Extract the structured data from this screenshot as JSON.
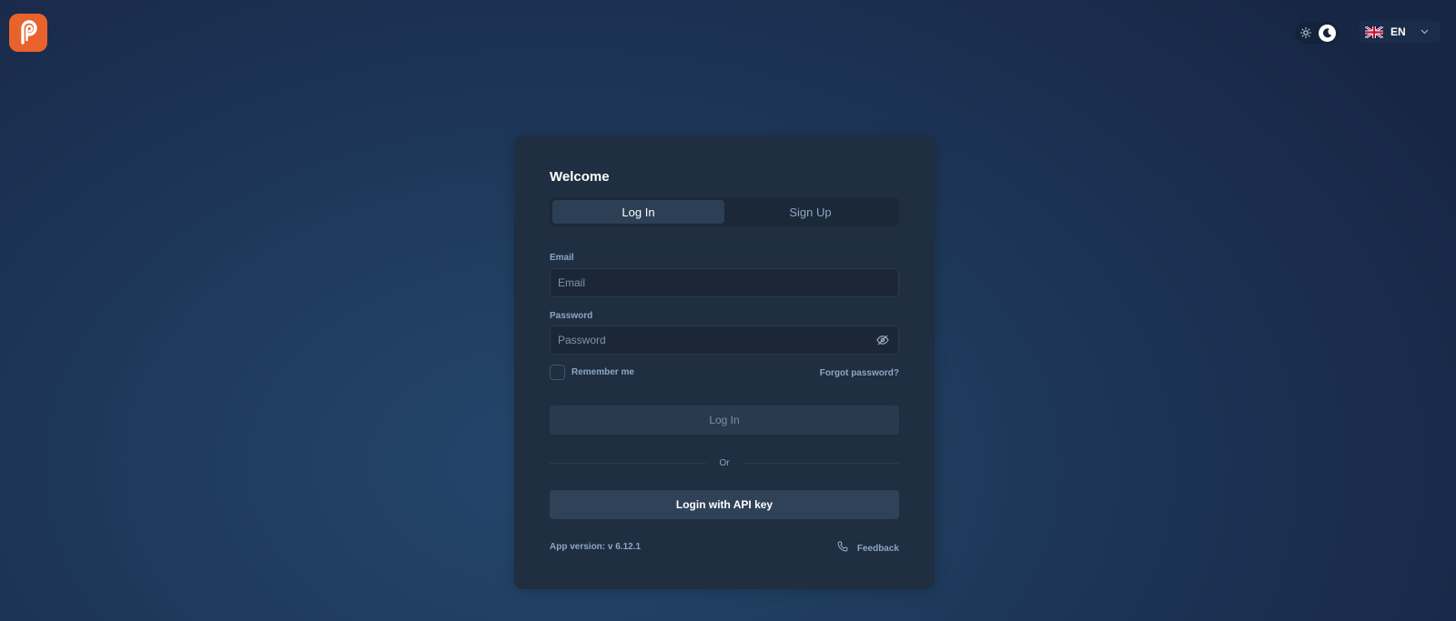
{
  "header": {
    "logo_icon": "app-logo-p-icon",
    "theme_toggle": {
      "light_icon": "sun-icon",
      "dark_icon": "moon-icon",
      "selected": "dark"
    },
    "language": {
      "flag_icon": "uk-flag-icon",
      "code": "EN",
      "chevron_icon": "chevron-down-icon"
    }
  },
  "login_card": {
    "title": "Welcome",
    "tabs": [
      {
        "label": "Log In",
        "active": true
      },
      {
        "label": "Sign Up",
        "active": false
      }
    ],
    "email": {
      "label": "Email",
      "placeholder": "Email",
      "value": ""
    },
    "password": {
      "label": "Password",
      "placeholder": "Password",
      "value": "",
      "toggle_icon": "eye-off-icon"
    },
    "remember_me": {
      "label": "Remember me",
      "checked": false
    },
    "forgot_password": "Forgot password?",
    "login_button": "Log In",
    "divider_text": "Or",
    "api_key_button": "Login with API key",
    "app_version": "App version: v 6.12.1",
    "feedback": {
      "label": "Feedback",
      "icon": "phone-icon"
    }
  },
  "colors": {
    "brand": "#e8622c",
    "card_background": "#1f2e40",
    "muted_text": "#8ea6c4"
  }
}
